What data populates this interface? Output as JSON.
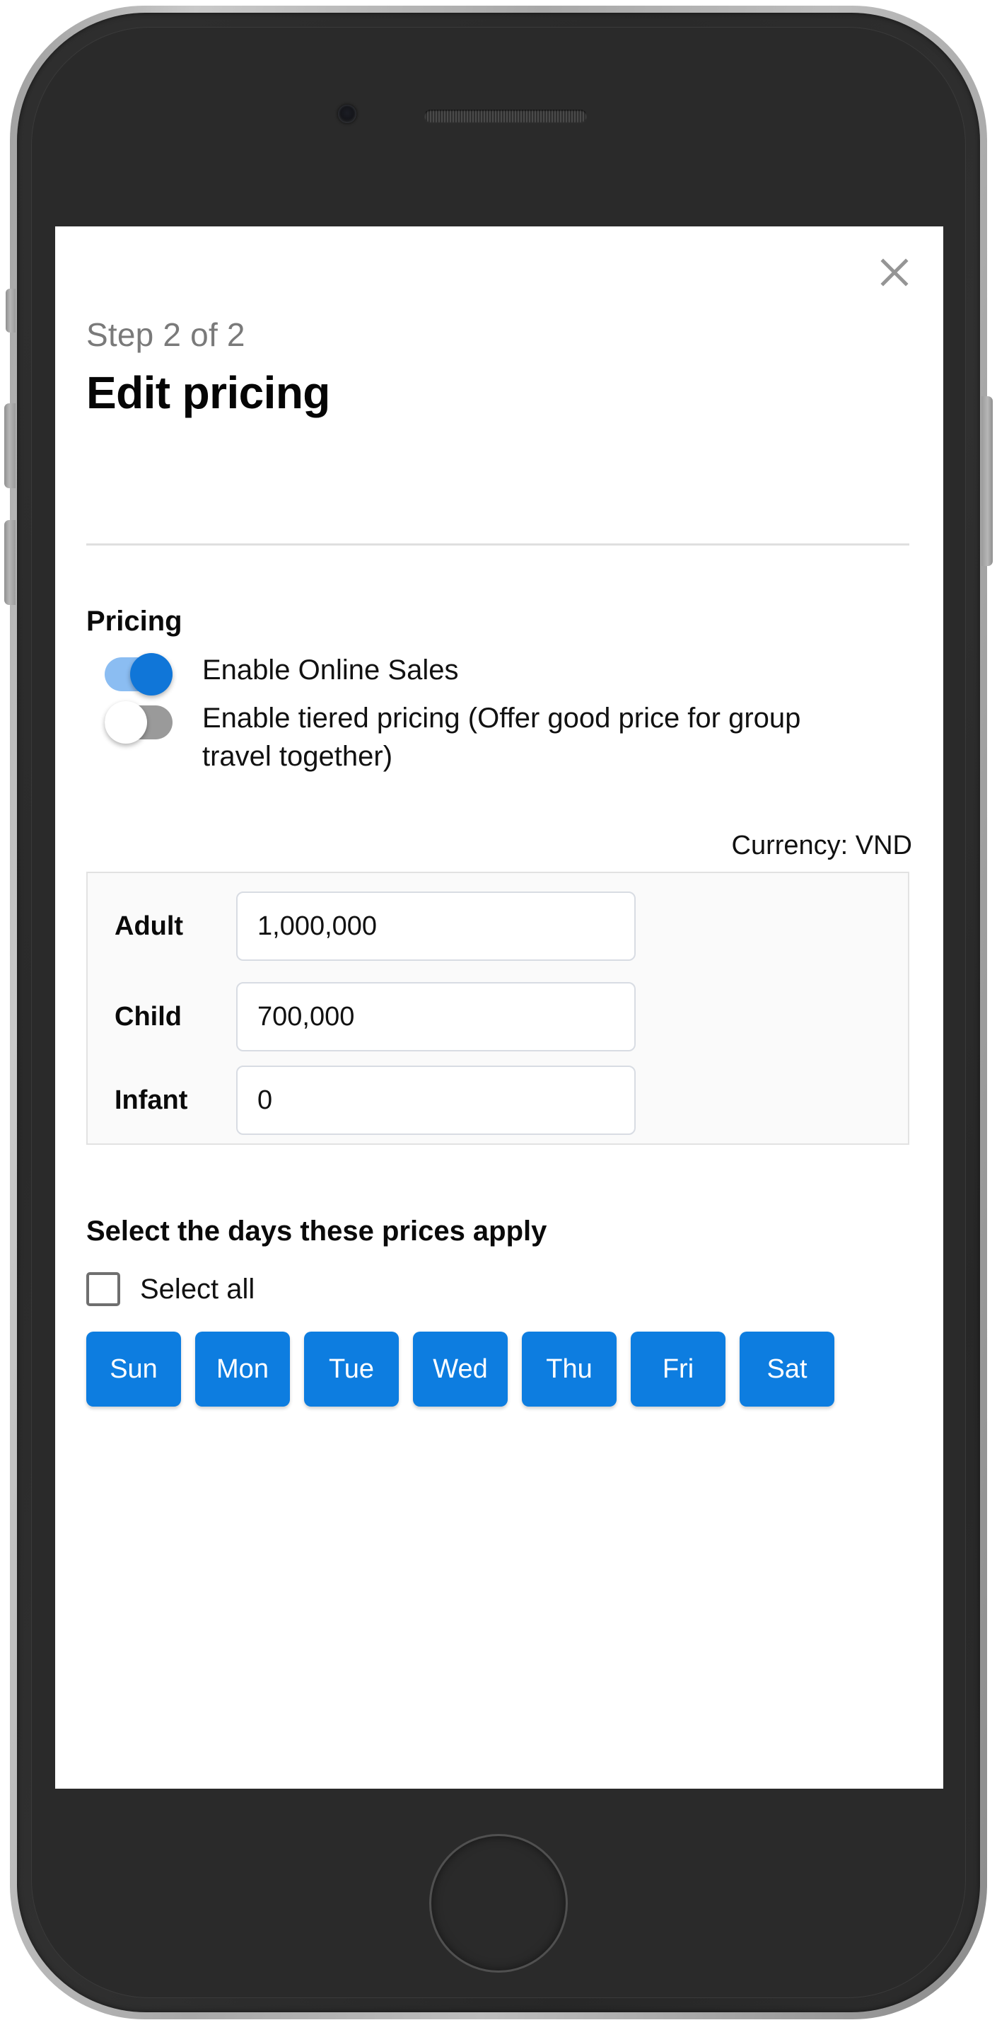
{
  "device": {
    "frame_color": "#2b2b2b",
    "rim_color": "#b0b0b0"
  },
  "dialog": {
    "close_icon": "close-icon",
    "step_label": "Step 2 of 2",
    "title": "Edit pricing"
  },
  "pricing_section": {
    "heading": "Pricing",
    "toggles": [
      {
        "label": "Enable Online Sales",
        "state": "on",
        "on_color": "#1076d8",
        "track_color": "#8bbdf2"
      },
      {
        "label": "Enable tiered pricing (Offer good price for group travel together)",
        "state": "off",
        "off_color": "#ffffff",
        "track_color": "#9a9a9a"
      }
    ],
    "currency_label": "Currency: VND",
    "rows": [
      {
        "label": "Adult",
        "value": "1,000,000",
        "placeholder": "0"
      },
      {
        "label": "Child",
        "value": "700,000",
        "placeholder": "0"
      },
      {
        "label": "Infant",
        "value": "0",
        "placeholder": "0"
      }
    ]
  },
  "days_section": {
    "heading": "Select the days these prices apply",
    "select_all_label": "Select all",
    "select_all_checked": false,
    "selected_color": "#0d7de0",
    "days": [
      {
        "label": "Sun",
        "selected": true
      },
      {
        "label": "Mon",
        "selected": true
      },
      {
        "label": "Tue",
        "selected": true
      },
      {
        "label": "Wed",
        "selected": true
      },
      {
        "label": "Thu",
        "selected": true
      },
      {
        "label": "Fri",
        "selected": true
      },
      {
        "label": "Sat",
        "selected": true
      }
    ]
  }
}
